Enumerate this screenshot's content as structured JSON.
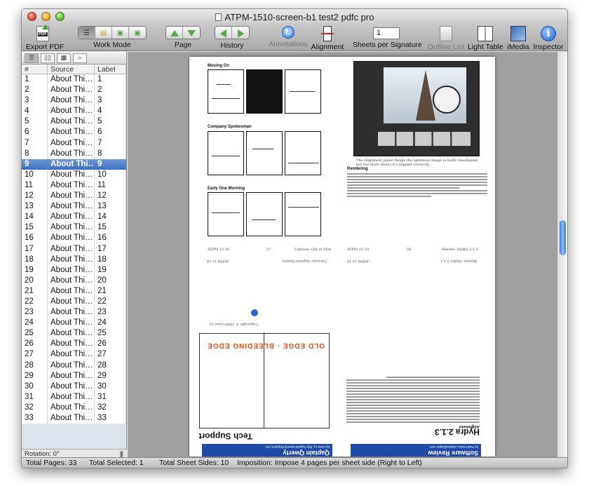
{
  "window": {
    "title": "ATPM-1510-screen-b1 test2 pdfc pro"
  },
  "toolbar": {
    "export_pdf": "Export PDF",
    "export_pdf_badge": "PDF",
    "work_mode": "Work Mode",
    "page": "Page",
    "history": "History",
    "annotations": "Annotations",
    "alignment": "Alignment",
    "sheets_per_signature": "Sheets per Signature",
    "sheets_value": "1",
    "outline_list": "Outline List",
    "light_table": "Light Table",
    "imedia": "iMedia",
    "inspector": "Inspector",
    "inspector_glyph": "i"
  },
  "sidebar": {
    "columns": [
      "#",
      "Source",
      "Label"
    ],
    "rows": [
      {
        "num": "1",
        "source": "About Thi…",
        "label": "1"
      },
      {
        "num": "2",
        "source": "About Thi…",
        "label": "2"
      },
      {
        "num": "3",
        "source": "About Thi…",
        "label": "3"
      },
      {
        "num": "4",
        "source": "About Thi…",
        "label": "4"
      },
      {
        "num": "5",
        "source": "About Thi…",
        "label": "5"
      },
      {
        "num": "6",
        "source": "About Thi…",
        "label": "6"
      },
      {
        "num": "7",
        "source": "About Thi…",
        "label": "7"
      },
      {
        "num": "8",
        "source": "About Thi…",
        "label": "8"
      },
      {
        "num": "9",
        "source": "About Thi…",
        "label": "9"
      },
      {
        "num": "10",
        "source": "About Thi…",
        "label": "10"
      },
      {
        "num": "11",
        "source": "About Thi…",
        "label": "11"
      },
      {
        "num": "12",
        "source": "About Thi…",
        "label": "12"
      },
      {
        "num": "13",
        "source": "About Thi…",
        "label": "13"
      },
      {
        "num": "14",
        "source": "About Thi…",
        "label": "14"
      },
      {
        "num": "15",
        "source": "About Thi…",
        "label": "15"
      },
      {
        "num": "16",
        "source": "About Thi…",
        "label": "16"
      },
      {
        "num": "17",
        "source": "About Thi…",
        "label": "17"
      },
      {
        "num": "18",
        "source": "About Thi…",
        "label": "18"
      },
      {
        "num": "19",
        "source": "About Thi…",
        "label": "19"
      },
      {
        "num": "20",
        "source": "About Thi…",
        "label": "20"
      },
      {
        "num": "21",
        "source": "About Thi…",
        "label": "21"
      },
      {
        "num": "22",
        "source": "About Thi…",
        "label": "22"
      },
      {
        "num": "23",
        "source": "About Thi…",
        "label": "23"
      },
      {
        "num": "24",
        "source": "About Thi…",
        "label": "24"
      },
      {
        "num": "25",
        "source": "About Thi…",
        "label": "25"
      },
      {
        "num": "26",
        "source": "About Thi…",
        "label": "26"
      },
      {
        "num": "27",
        "source": "About Thi…",
        "label": "27"
      },
      {
        "num": "28",
        "source": "About Thi…",
        "label": "28"
      },
      {
        "num": "29",
        "source": "About Thi…",
        "label": "29"
      },
      {
        "num": "30",
        "source": "About Thi…",
        "label": "30"
      },
      {
        "num": "31",
        "source": "About Thi…",
        "label": "31"
      },
      {
        "num": "32",
        "source": "About Thi…",
        "label": "32"
      },
      {
        "num": "33",
        "source": "About Thi…",
        "label": "33"
      }
    ],
    "selected_index": 8,
    "rotation": "Rotation: 0°"
  },
  "page": {
    "strip1": "Moving On",
    "strip2": "Company Spokesman",
    "strip3": "Early One Morning",
    "caption": "The Alignment panel thinks the lightmost image is badly misaligned, but the blurs shows it's aligned correctly.",
    "section": "Rendering",
    "footer_left": "ATPM 15.10",
    "footer_left_num": "27",
    "footer_left_title": "Cartoon: Out at Five",
    "footer_right": "ATPM 15.10",
    "footer_right_num": "28",
    "footer_right_title": "Review: Hydra 2.1.3",
    "inv_footer_left": "Cartoon: Qaptain Qwerty",
    "inv_footer_left_tag": "ATPM 15.10",
    "inv_footer_right": "Review: Hydra 2.1.3",
    "inv_footer_right_tag": "ATPM 15.10",
    "inv_copyright": "Copyright © 2009 Linus Ly",
    "inv_subhead": "Alignment",
    "inv_header_left": "Qaptain Qwerty",
    "inv_header_left_by": "by Linus Ly, http://qaptainqwerty.blogspot.com",
    "inv_header_right": "Software Review",
    "inv_header_right_by": "by Paul Fatula, pfatula@atpm.com",
    "inv_title_left": "Tech Support",
    "inv_title_right": "Hydra 2.1.3",
    "comic_logo": "OLD EDGE · BLEEDING EDGE"
  },
  "status": {
    "total_pages": "Total Pages:  33",
    "total_selected": "Total Selected:  1",
    "total_sheet_sides": "Total Sheet Sides:  10",
    "imposition": "Imposition:  Impose 4 pages per sheet side (Right to Left)"
  },
  "colors": {
    "selection": "#3e6ec0",
    "accent_blue": "#2a64c8",
    "page_header_blue": "#1f4aa8",
    "green_arrow": "#58a84a"
  }
}
